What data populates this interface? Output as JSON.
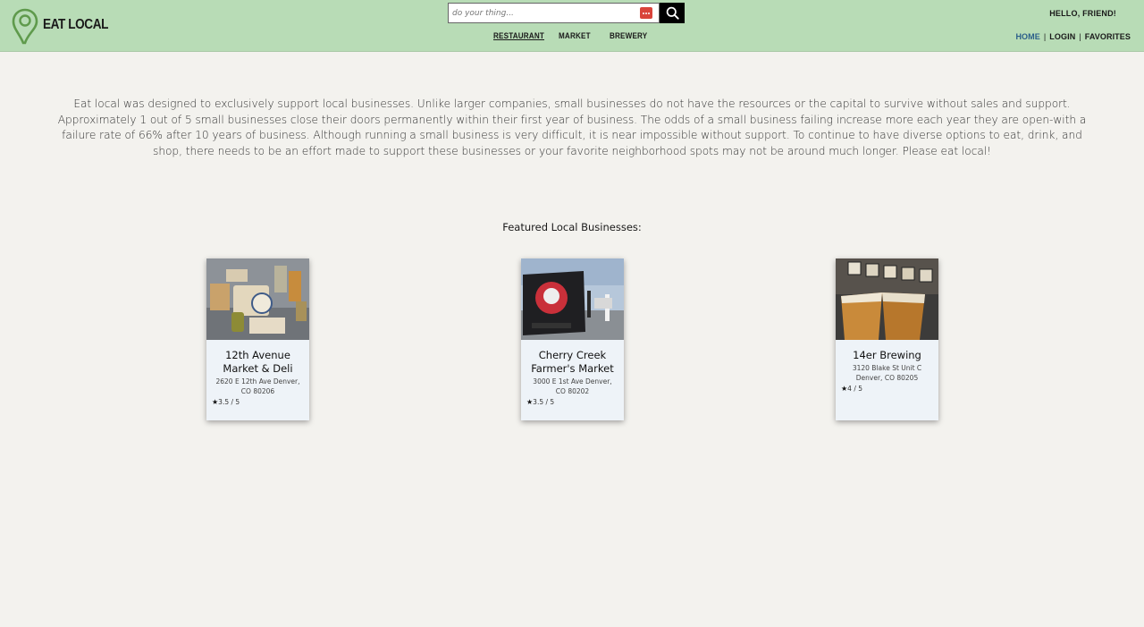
{
  "header": {
    "brand": "EAT LOCAL",
    "search": {
      "placeholder": "do your thing..."
    },
    "categories": [
      "RESTAURANT",
      "MARKET",
      "BREWERY"
    ],
    "active_category": "RESTAURANT",
    "greeting": "HELLO, FRIEND!",
    "nav": {
      "home": "HOME",
      "login": "LOGIN",
      "favorites": "FAVORITES",
      "separator": "|"
    }
  },
  "intro": "Eat local was designed to exclusively support local businesses. Unlike larger companies, small businesses do not have the resources or the capital to survive without sales and support. Approximately 1 out of 5 small businesses close their doors permanently within their first year of business. The odds of a small business failing increase more each year they are open-with a failure rate of 66% after 10 years of business. Although running a small business is very difficult, it is near impossible without support. To continue to have diverse options to eat, drink, and shop, there needs to be an effort made to support these businesses or your favorite neighborhood spots may not be around much longer. Please eat local!",
  "featured": {
    "title": "Featured Local Businesses:",
    "cards": [
      {
        "name": "12th Avenue Market & Deli",
        "address": "2620 E 12th Ave Denver, CO 80206",
        "rating": "3.5 / 5",
        "star": "★"
      },
      {
        "name": "Cherry Creek Farmer's Market",
        "address": "3000 E 1st Ave Denver, CO 80202",
        "rating": "3.5 / 5",
        "star": "★"
      },
      {
        "name": "14er Brewing",
        "address": "3120 Blake St Unit C Denver, CO 80205",
        "rating": "4 / 5",
        "star": "★"
      }
    ]
  },
  "colors": {
    "header_bg": "#b8dcb6",
    "page_bg": "#f3f2ee",
    "card_bg": "#eef3f8",
    "active_nav": "#2b5f8a",
    "logo_green": "#5f9a4c"
  },
  "icons": {
    "logo": "map-pin-icon",
    "search": "search-icon",
    "extension": "password-manager-icon",
    "rating": "star-icon"
  }
}
